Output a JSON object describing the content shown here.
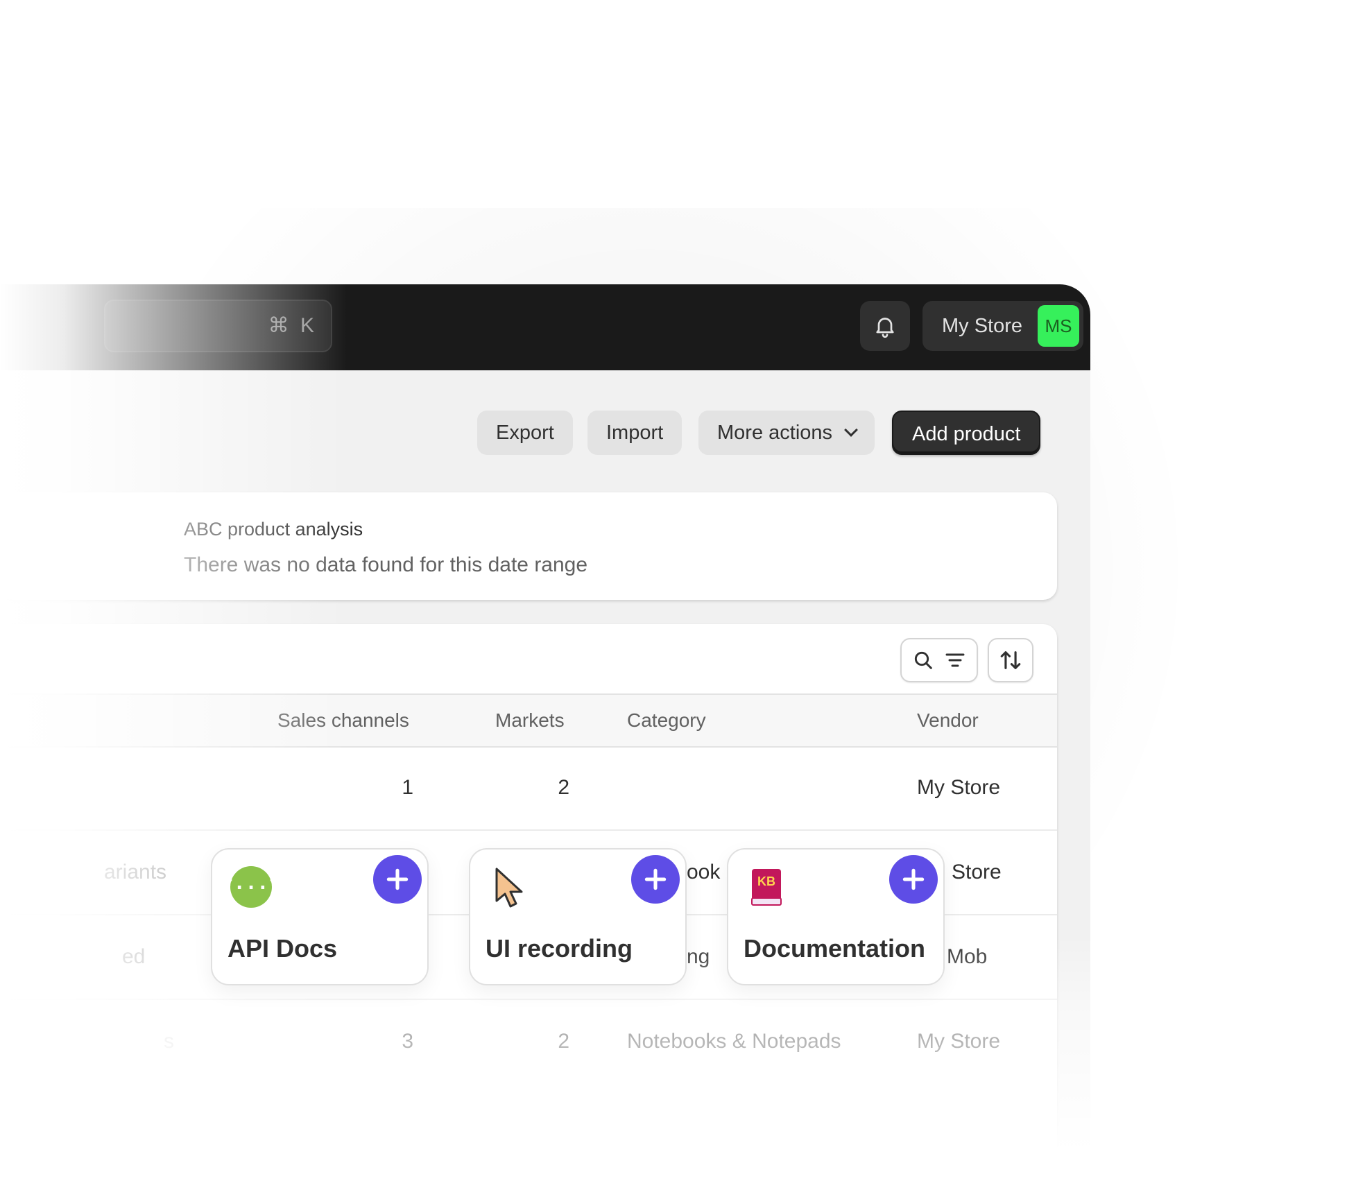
{
  "topbar": {
    "search_shortcut": "⌘ K",
    "store_name": "My Store",
    "avatar_initials": "MS",
    "avatar_color": "#36f05b"
  },
  "actions": {
    "export_label": "Export",
    "import_label": "Import",
    "more_actions_label": "More actions",
    "add_product_label": "Add product"
  },
  "analysis": {
    "title": "ABC product analysis",
    "message": "There was no data found for this date range"
  },
  "table": {
    "columns": [
      "Sales channels",
      "Markets",
      "Category",
      "Vendor"
    ],
    "rows": [
      {
        "lead": "",
        "sales_channels": "1",
        "markets": "2",
        "category": "",
        "vendor": "My Store"
      },
      {
        "lead": "ariants",
        "sales_channels": "",
        "markets": "",
        "category": "ook",
        "vendor": "Store"
      },
      {
        "lead": "ed",
        "sales_channels": "",
        "markets": "",
        "category": "ng",
        "vendor": "Mob"
      },
      {
        "lead": "s",
        "sales_channels": "3",
        "markets": "2",
        "category": "Notebooks & Notepads",
        "vendor": "My Store"
      }
    ]
  },
  "integrations": [
    {
      "label": "API Docs",
      "icon": "api-braces-icon"
    },
    {
      "label": "UI recording",
      "icon": "cursor-icon"
    },
    {
      "label": "Documentation",
      "icon": "kb-book-icon",
      "icon_text": "KB"
    }
  ],
  "colors": {
    "accent_purple": "#5e4de6",
    "topbar": "#1a1a1a",
    "api_icon_green": "#8bc34a",
    "kb_book": "#c2185b"
  }
}
